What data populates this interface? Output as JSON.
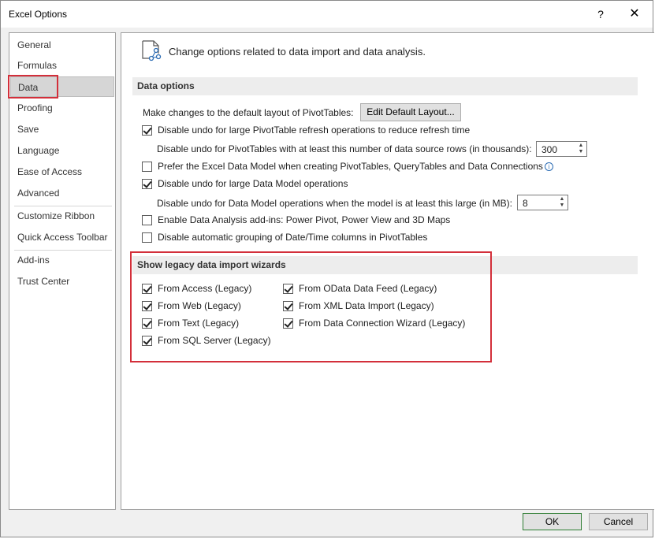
{
  "window": {
    "title": "Excel Options",
    "help_glyph": "?",
    "close_glyph": "✕"
  },
  "sidebar": {
    "items": [
      {
        "label": "General"
      },
      {
        "label": "Formulas"
      },
      {
        "label": "Data"
      },
      {
        "label": "Proofing"
      },
      {
        "label": "Save"
      },
      {
        "label": "Language"
      },
      {
        "label": "Ease of Access"
      },
      {
        "label": "Advanced"
      },
      {
        "label": "Customize Ribbon"
      },
      {
        "label": "Quick Access Toolbar"
      },
      {
        "label": "Add-ins"
      },
      {
        "label": "Trust Center"
      }
    ],
    "selected": "Data"
  },
  "main": {
    "header_text": "Change options related to data import and data analysis.",
    "header_icon": "data-connection-icon",
    "data_options": {
      "title": "Data options",
      "default_layout_text": "Make changes to the default layout of PivotTables:",
      "edit_layout_button": "Edit Default Layout...",
      "disable_undo_pivot": {
        "label": "Disable undo for large PivotTable refresh operations to reduce refresh time",
        "checked": true
      },
      "pivot_rows_text": "Disable undo for PivotTables with at least this number of data source rows (in thousands):",
      "pivot_rows_value": "300",
      "prefer_data_model": {
        "label": "Prefer the Excel Data Model when creating PivotTables, QueryTables and Data Connections",
        "checked": false
      },
      "info_glyph": "i",
      "disable_undo_model": {
        "label": "Disable undo for large Data Model operations",
        "checked": true
      },
      "model_size_text": "Disable undo for Data Model operations when the model is at least this large (in MB):",
      "model_size_value": "8",
      "enable_addins": {
        "label": "Enable Data Analysis add-ins: Power Pivot, Power View and 3D Maps",
        "checked": false
      },
      "disable_grouping": {
        "label": "Disable automatic grouping of Date/Time columns in PivotTables",
        "checked": false
      }
    },
    "legacy": {
      "title": "Show legacy data import wizards",
      "items": [
        {
          "label": "From Access (Legacy)",
          "checked": true
        },
        {
          "label": "From Web (Legacy)",
          "checked": true
        },
        {
          "label": "From Text (Legacy)",
          "checked": true
        },
        {
          "label": "From SQL Server (Legacy)",
          "checked": true
        },
        {
          "label": "From OData Data Feed (Legacy)",
          "checked": true
        },
        {
          "label": "From XML Data Import (Legacy)",
          "checked": true
        },
        {
          "label": "From Data Connection Wizard (Legacy)",
          "checked": true
        }
      ]
    }
  },
  "footer": {
    "ok_label": "OK",
    "cancel_label": "Cancel"
  },
  "colors": {
    "highlight_border": "#d32f3a",
    "ok_border": "#2e7d32"
  }
}
